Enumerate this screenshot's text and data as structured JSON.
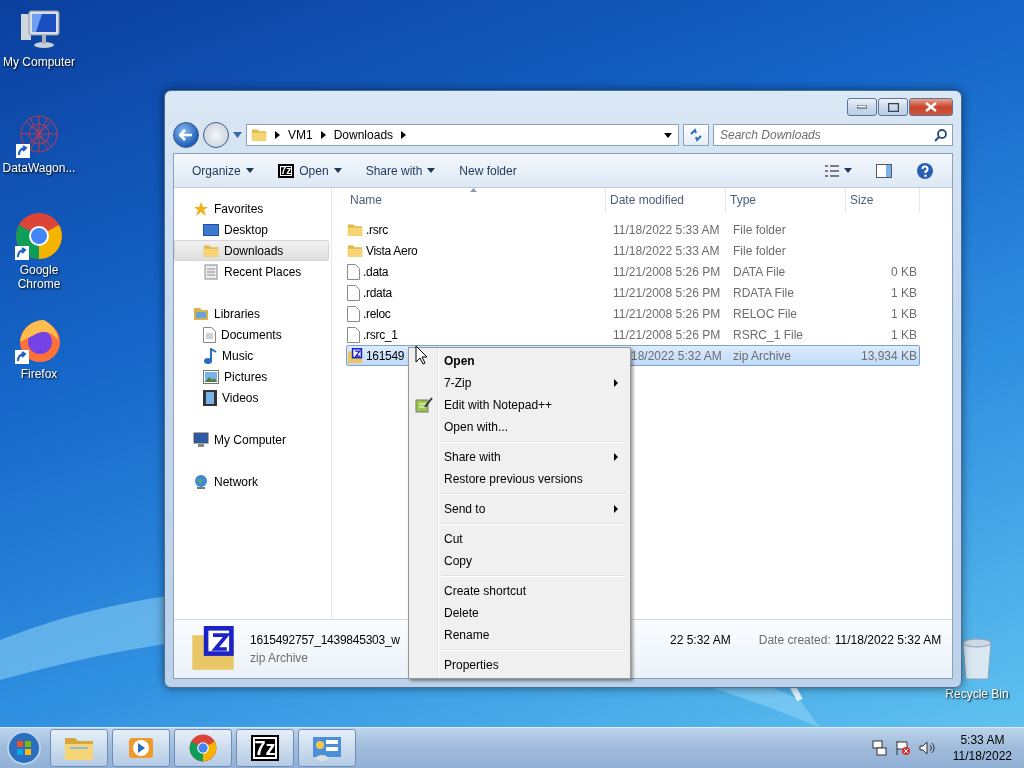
{
  "desktop_icons": [
    {
      "kind": "computer",
      "label": "My Computer"
    },
    {
      "kind": "network-art",
      "label": "DataWagon..."
    },
    {
      "kind": "chrome",
      "label": "Google Chrome"
    },
    {
      "kind": "firefox",
      "label": "Firefox"
    }
  ],
  "recycle_bin": {
    "label": "Recycle Bin"
  },
  "explorer": {
    "breadcrumb": [
      "VM1",
      "Downloads"
    ],
    "search": {
      "placeholder": "Search Downloads"
    },
    "toolbar": [
      {
        "kind": "menu",
        "label": "Organize",
        "dropdown": true
      },
      {
        "kind": "open",
        "label": "Open",
        "icon_text": "7z",
        "dropdown": true
      },
      {
        "kind": "menu",
        "label": "Share with",
        "dropdown": true
      },
      {
        "kind": "menu",
        "label": "New folder",
        "dropdown": false
      }
    ],
    "nav": [
      {
        "kind": "star",
        "label": "Favorites",
        "selected": false,
        "children": [
          {
            "kind": "desktop",
            "label": "Desktop",
            "selected": false
          },
          {
            "kind": "downloads",
            "label": "Downloads",
            "selected": true
          },
          {
            "kind": "recent",
            "label": "Recent Places",
            "selected": false
          }
        ]
      },
      {
        "kind": "libraries",
        "label": "Libraries",
        "selected": false,
        "children": [
          {
            "kind": "document",
            "label": "Documents",
            "selected": false
          },
          {
            "kind": "music",
            "label": "Music",
            "selected": false
          },
          {
            "kind": "pictures",
            "label": "Pictures",
            "selected": false
          },
          {
            "kind": "videos",
            "label": "Videos",
            "selected": false
          }
        ]
      },
      {
        "kind": "computer",
        "label": "My Computer",
        "selected": false
      },
      {
        "kind": "network",
        "label": "Network",
        "selected": false
      }
    ],
    "columns": [
      "Name",
      "Date modified",
      "Type",
      "Size"
    ],
    "rows": [
      {
        "kind": "folder",
        "name": ".rsrc",
        "modified": "11/18/2022 5:33 AM",
        "type": "File folder",
        "selected": false
      },
      {
        "kind": "folder",
        "name": "Vista Aero",
        "modified": "11/18/2022 5:33 AM",
        "type": "File folder",
        "selected": false
      },
      {
        "kind": "file",
        "name": ".data",
        "modified": "11/21/2008 5:26 PM",
        "type": "DATA File",
        "size": "0 KB",
        "selected": false
      },
      {
        "kind": "file",
        "name": ".rdata",
        "modified": "11/21/2008 5:26 PM",
        "type": "RDATA File",
        "size": "1 KB",
        "selected": false
      },
      {
        "kind": "file",
        "name": ".reloc",
        "modified": "11/21/2008 5:26 PM",
        "type": "RELOC File",
        "size": "1 KB",
        "selected": false
      },
      {
        "kind": "file",
        "name": ".rsrc_1",
        "modified": "11/21/2008 5:26 PM",
        "type": "RSRC_1 File",
        "size": "1 KB",
        "selected": false
      },
      {
        "kind": "zip",
        "name": "161549",
        "modified": "18/2022 5:32 AM",
        "type": "zip Archive",
        "size": "13,934 KB",
        "selected": true
      }
    ],
    "details": {
      "name": "1615492757_1439845303_w",
      "type": "zip Archive",
      "modified": "22 5:32 AM",
      "created_label": "Date created:",
      "created": "11/18/2022 5:32 AM"
    }
  },
  "context_menu": [
    [
      {
        "kind": "plain",
        "label": "Open",
        "default": true,
        "submenu": false
      },
      {
        "kind": "plain",
        "label": "7-Zip",
        "default": false,
        "submenu": true
      },
      {
        "kind": "notepad",
        "label": "Edit with Notepad++",
        "default": false,
        "submenu": false
      },
      {
        "kind": "plain",
        "label": "Open with...",
        "default": false,
        "submenu": false
      }
    ],
    [
      {
        "kind": "plain",
        "label": "Share with",
        "default": false,
        "submenu": true
      },
      {
        "kind": "plain",
        "label": "Restore previous versions",
        "default": false,
        "submenu": false
      }
    ],
    [
      {
        "kind": "plain",
        "label": "Send to",
        "default": false,
        "submenu": true
      }
    ],
    [
      {
        "kind": "plain",
        "label": "Cut",
        "default": false,
        "submenu": false
      },
      {
        "kind": "plain",
        "label": "Copy",
        "default": false,
        "submenu": false
      }
    ],
    [
      {
        "kind": "plain",
        "label": "Create shortcut",
        "default": false,
        "submenu": false
      },
      {
        "kind": "plain",
        "label": "Delete",
        "default": false,
        "submenu": false
      },
      {
        "kind": "plain",
        "label": "Rename",
        "default": false,
        "submenu": false
      }
    ],
    [
      {
        "kind": "plain",
        "label": "Properties",
        "default": false,
        "submenu": false
      }
    ]
  ],
  "taskbar": {
    "apps": [
      {
        "kind": "explorer"
      },
      {
        "kind": "media"
      },
      {
        "kind": "chrome"
      },
      {
        "kind": "sevenzip",
        "text": "7z"
      },
      {
        "kind": "control"
      }
    ],
    "clock": {
      "time": "5:33 AM",
      "date": "11/18/2022"
    }
  }
}
